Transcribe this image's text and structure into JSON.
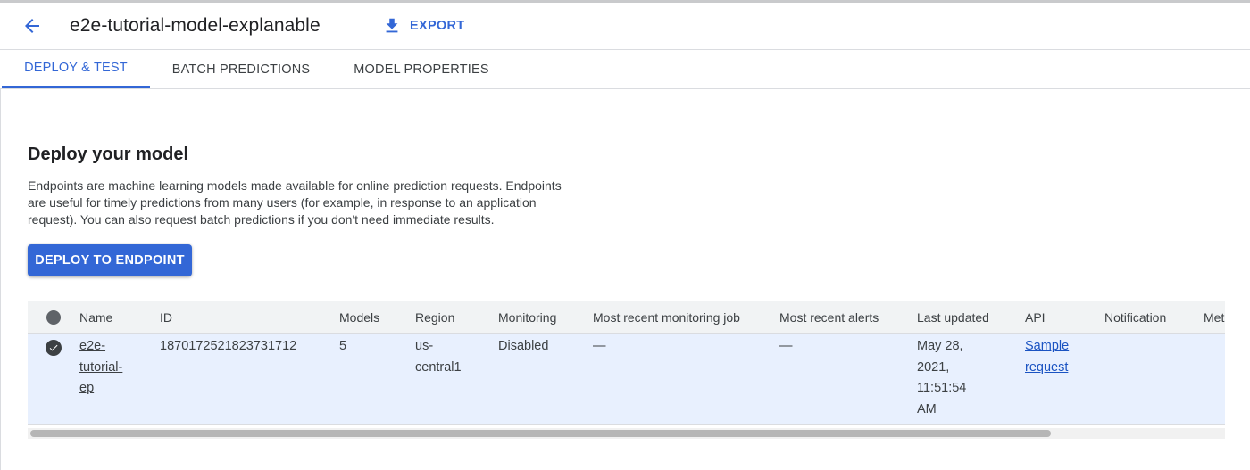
{
  "header": {
    "title": "e2e-tutorial-model-explanable",
    "export_label": "EXPORT",
    "back_icon": "arrow-back-icon",
    "export_icon": "download-icon"
  },
  "tabs": [
    {
      "label": "DEPLOY & TEST",
      "active": true
    },
    {
      "label": "BATCH PREDICTIONS",
      "active": false
    },
    {
      "label": "MODEL PROPERTIES",
      "active": false
    }
  ],
  "section": {
    "title": "Deploy your model",
    "description": "Endpoints are machine learning models made available for online prediction requests. Endpoints are useful for timely predictions from many users (for example, in response to an application request). You can also request batch predictions if you don't need immediate results.",
    "deploy_button": "DEPLOY TO ENDPOINT"
  },
  "table": {
    "columns": [
      "Name",
      "ID",
      "Models",
      "Region",
      "Monitoring",
      "Most recent monitoring job",
      "Most recent alerts",
      "Last updated",
      "API",
      "Notification",
      "Met"
    ],
    "rows": [
      {
        "selected": true,
        "name": "e2e-tutorial-ep",
        "id": "1870172521823731712",
        "models": "5",
        "region": "us-central1",
        "monitoring": "Disabled",
        "recent_monitoring_job": "—",
        "recent_alerts": "—",
        "last_updated": "May 28, 2021, 11:51:54 AM",
        "api": "Sample request",
        "notification": ""
      }
    ]
  },
  "colors": {
    "accent": "#3367d6",
    "selected_row": "#e8f0fe",
    "header_row": "#f1f3f4"
  }
}
